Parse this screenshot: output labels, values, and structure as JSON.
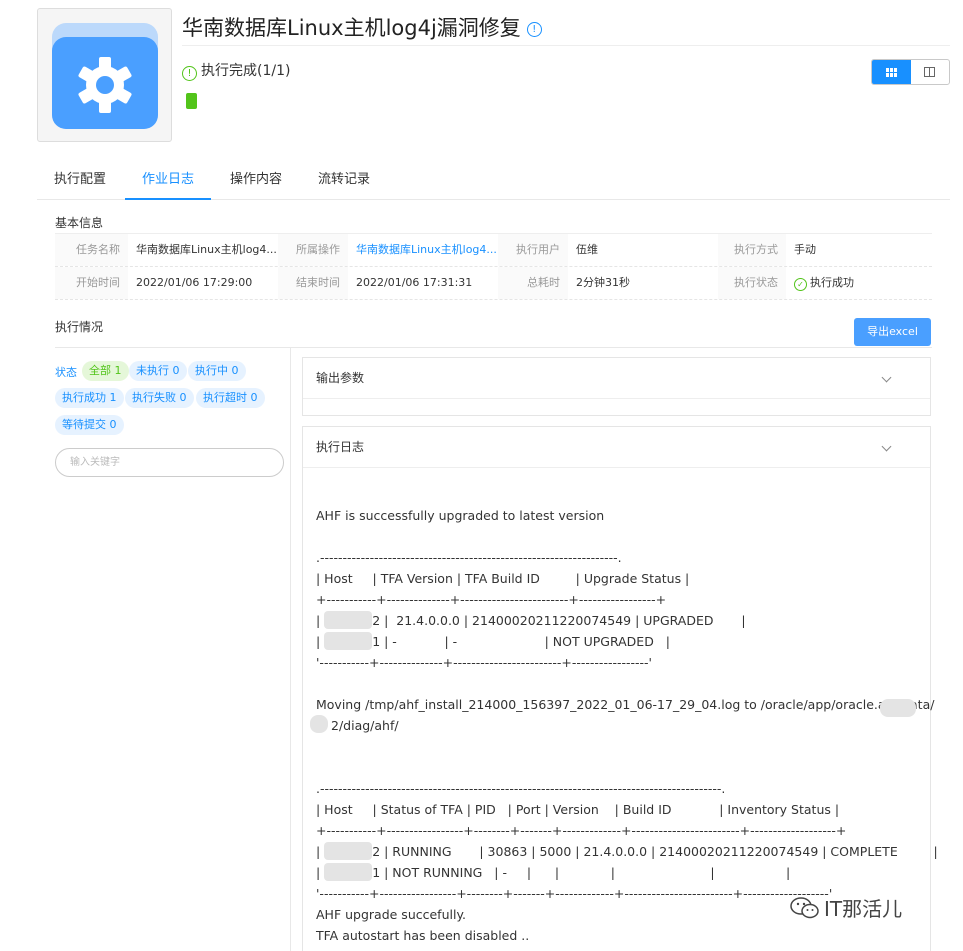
{
  "header": {
    "title": "华南数据库Linux主机log4j漏洞修复",
    "status_text": "执行完成(1/1)"
  },
  "tabs": [
    "执行配置",
    "作业日志",
    "操作内容",
    "流转记录"
  ],
  "basic_info": {
    "section_title": "基本信息",
    "row1": {
      "task_name_label": "任务名称",
      "task_name": "华南数据库Linux主机log4...",
      "operation_label": "所属操作",
      "operation": "华南数据库Linux主机log4...",
      "user_label": "执行用户",
      "user": "伍维",
      "mode_label": "执行方式",
      "mode": "手动"
    },
    "row2": {
      "start_label": "开始时间",
      "start": "2022/01/06 17:29:00",
      "end_label": "结束时间",
      "end": "2022/01/06 17:31:31",
      "duration_label": "总耗时",
      "duration": "2分钟31秒",
      "state_label": "执行状态",
      "state": "执行成功"
    }
  },
  "execution": {
    "section_title": "执行情况",
    "export_button": "导出excel",
    "status_label": "状态",
    "filters": [
      "全部 1",
      "未执行 0",
      "执行中 0",
      "执行成功 1",
      "执行失败 0",
      "执行超时 0",
      "等待提交 0"
    ],
    "search_placeholder": "输入关键字"
  },
  "panels": {
    "output_params": "输出参数",
    "exec_log": "执行日志"
  },
  "log_lines": {
    "l1": "AHF is successfully upgraded to latest version",
    "l2": ".------------------------------------------------------------------.",
    "l3": "| Host     | TFA Version | TFA Build ID         | Upgrade Status |",
    "l4": "+-----------+--------------+------------------------+-----------------+",
    "l5": "2 |  21.4.0.0.0 | 21400020211220074549 | UPGRADED       |",
    "l6": "1 | -            | -                      | NOT UPGRADED   |",
    "l7": "'-----------+--------------+------------------------+-----------------'",
    "l8": "Moving /tmp/ahf_install_214000_156397_2022_01_06-17_29_04.log to /oracle/app/oracle.ahf/data/",
    "l9": "2/diag/ahf/",
    "l10": ".-----------------------------------------------------------------------------------------.",
    "l11": "| Host     | Status of TFA | PID   | Port | Version    | Build ID            | Inventory Status |",
    "l12": "+-----------+-----------------+--------+-------+-------------+------------------------+-------------------+",
    "l13": "2 | RUNNING       | 30863 | 5000 | 21.4.0.0.0 | 21400020211220074549 | COMPLETE         |",
    "l14": "1 | NOT RUNNING   | -     |      |             |                        |                  |",
    "l15": "'-----------+-----------------+--------+-------+-------------+------------------------+-------------------'",
    "l16": "AHF upgrade succefully.",
    "l17": "TFA autostart has been disabled .."
  },
  "watermark": "IT那活儿"
}
